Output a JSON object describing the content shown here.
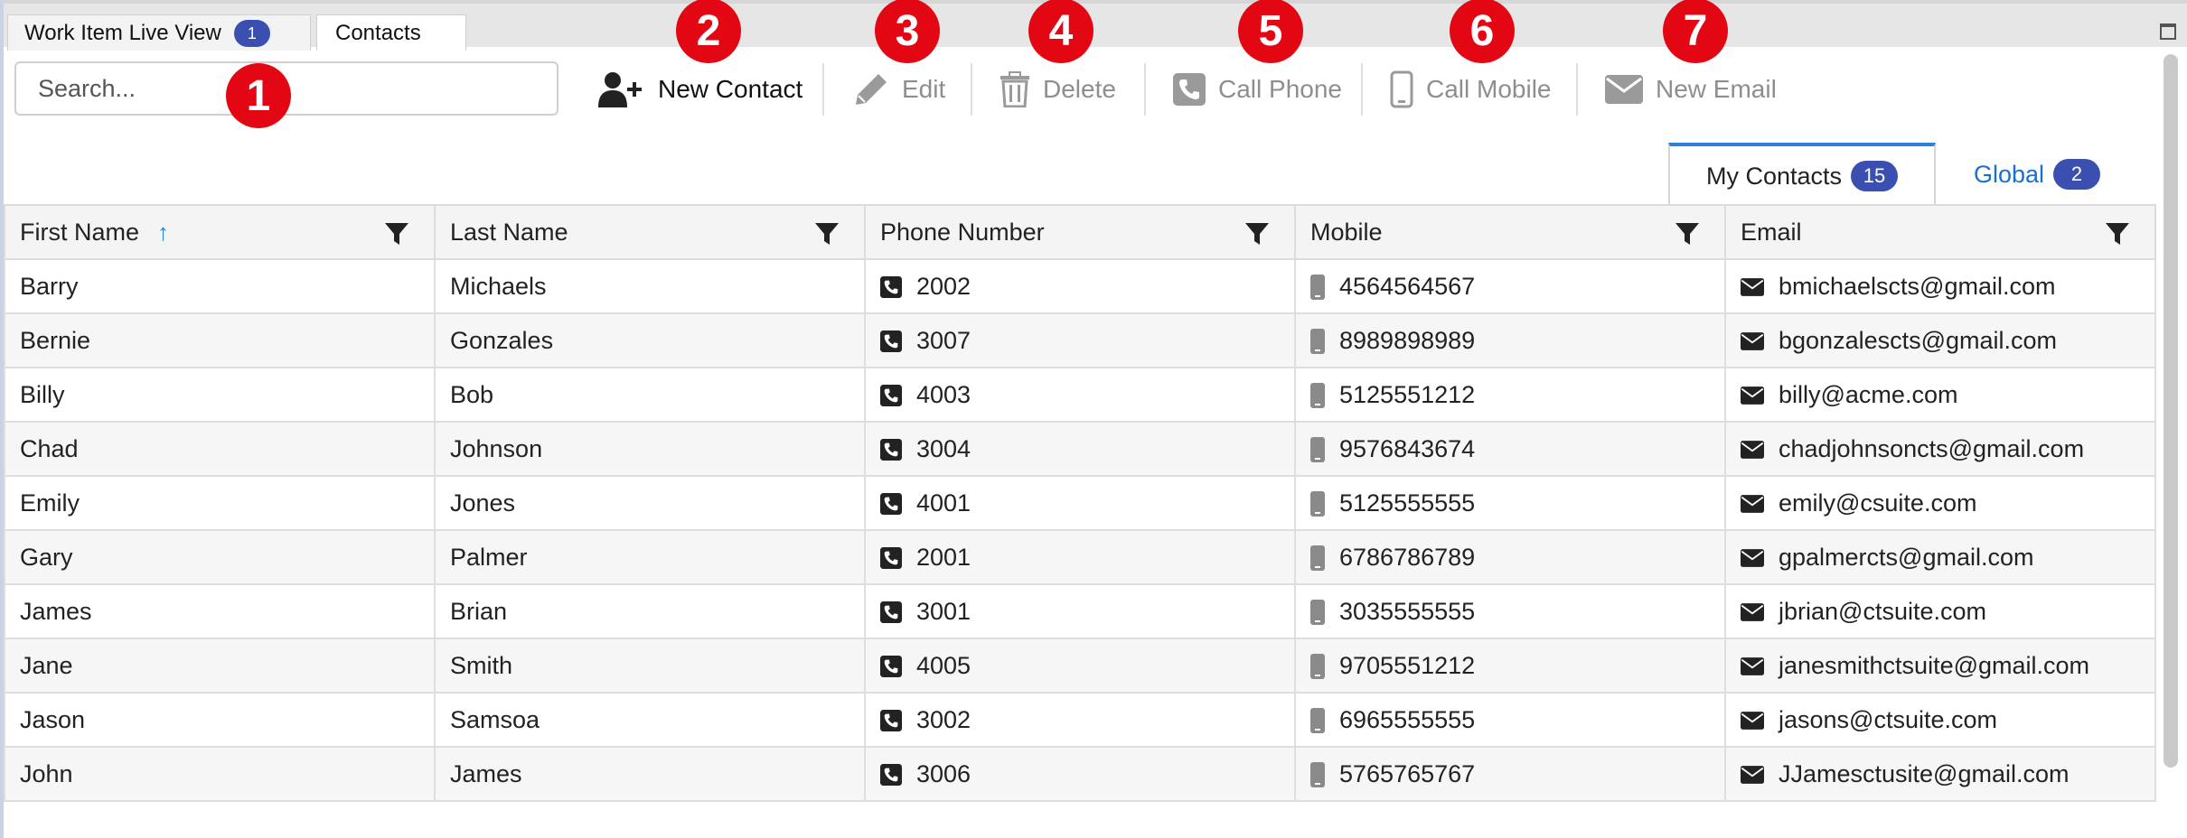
{
  "window_tabs": [
    {
      "label": "Work Item Live View",
      "badge": "1"
    },
    {
      "label": "Contacts"
    }
  ],
  "search": {
    "placeholder": "Search..."
  },
  "toolbar": {
    "new_contact": "New Contact",
    "edit": "Edit",
    "delete": "Delete",
    "call_phone": "Call Phone",
    "call_mobile": "Call Mobile",
    "new_email": "New Email"
  },
  "markers": [
    "1",
    "2",
    "3",
    "4",
    "5",
    "6",
    "7"
  ],
  "contact_tabs": [
    {
      "label": "My Contacts",
      "count": "15"
    },
    {
      "label": "Global",
      "count": "2"
    }
  ],
  "columns": [
    "First Name",
    "Last Name",
    "Phone Number",
    "Mobile",
    "Email"
  ],
  "rows": [
    {
      "first": "Barry",
      "last": "Michaels",
      "phone": "2002",
      "mobile": "4564564567",
      "email": "bmichaelscts@gmail.com"
    },
    {
      "first": "Bernie",
      "last": "Gonzales",
      "phone": "3007",
      "mobile": "8989898989",
      "email": "bgonzalescts@gmail.com"
    },
    {
      "first": "Billy",
      "last": "Bob",
      "phone": "4003",
      "mobile": "5125551212",
      "email": "billy@acme.com"
    },
    {
      "first": "Chad",
      "last": "Johnson",
      "phone": "3004",
      "mobile": "9576843674",
      "email": "chadjohnsoncts@gmail.com"
    },
    {
      "first": "Emily",
      "last": "Jones",
      "phone": "4001",
      "mobile": "5125555555",
      "email": "emily@csuite.com"
    },
    {
      "first": "Gary",
      "last": "Palmer",
      "phone": "2001",
      "mobile": "6786786789",
      "email": "gpalmercts@gmail.com"
    },
    {
      "first": "James",
      "last": "Brian",
      "phone": "3001",
      "mobile": "3035555555",
      "email": "jbrian@ctsuite.com"
    },
    {
      "first": "Jane",
      "last": "Smith",
      "phone": "4005",
      "mobile": "9705551212",
      "email": "janesmithctsuite@gmail.com"
    },
    {
      "first": "Jason",
      "last": "Samsoa",
      "phone": "3002",
      "mobile": "6965555555",
      "email": "jasons@ctsuite.com"
    },
    {
      "first": "John",
      "last": "James",
      "phone": "3006",
      "mobile": "5765765767",
      "email": "JJamesctusite@gmail.com"
    }
  ],
  "colors": {
    "accent": "#2f80d8",
    "badge": "#3a4fb0",
    "marker": "#e30613",
    "disabled": "#8e8e8e"
  },
  "icons": [
    "user-plus-icon",
    "pencil-icon",
    "trash-icon",
    "phone-icon",
    "mobile-icon",
    "envelope-icon",
    "filter-icon",
    "sort-up-icon",
    "maximize-icon"
  ]
}
